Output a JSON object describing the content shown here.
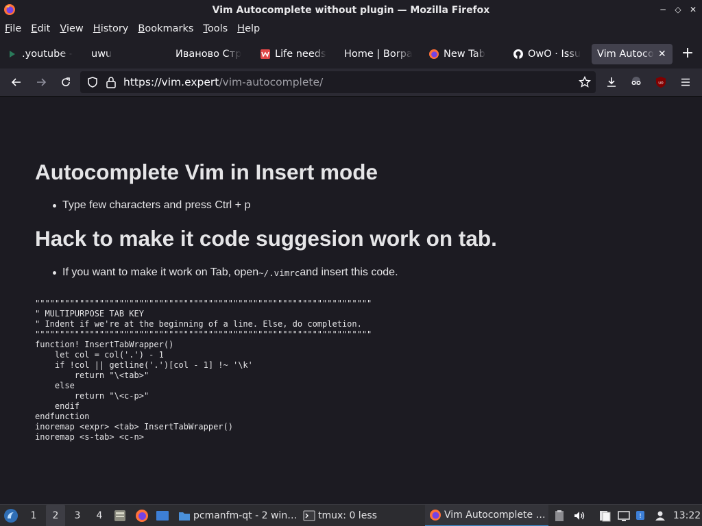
{
  "window": {
    "title": "Vim Autocomplete without plugin — Mozilla Firefox",
    "controls": [
      "−",
      "◇",
      "✕"
    ]
  },
  "menu": [
    "File",
    "Edit",
    "View",
    "History",
    "Bookmarks",
    "Tools",
    "Help"
  ],
  "tabs": [
    {
      "label": ".youtube -",
      "icon": "youtube-favicon"
    },
    {
      "label": "uwu",
      "icon": "none"
    },
    {
      "label": "Иваново Стр",
      "icon": "none"
    },
    {
      "label": "Life needs",
      "icon": "red-favicon"
    },
    {
      "label": "Home | Borpa",
      "icon": "none"
    },
    {
      "label": "New Tab",
      "icon": "firefox-favicon"
    },
    {
      "label": "OwO · Issu",
      "icon": "github-favicon"
    },
    {
      "label": "Vim Autoco",
      "icon": "none",
      "active": true
    }
  ],
  "newtab_label": "+",
  "url": {
    "host": "https://vim.expert",
    "path": "/vim-autocomplete/"
  },
  "page": {
    "heading1": "Autocomplete Vim in Insert mode",
    "bullet1": "Type few characters and press Ctrl + p",
    "heading2": "Hack to make it code suggesion work on tab.",
    "bullet2_pre": "If you want to make it work on Tab, open ",
    "bullet2_code": "~/.vimrc",
    "bullet2_post": " and insert this code.",
    "code": "\"\"\"\"\"\"\"\"\"\"\"\"\"\"\"\"\"\"\"\"\"\"\"\"\"\"\"\"\"\"\"\"\"\"\"\"\"\"\"\"\"\"\"\"\"\"\"\"\"\"\"\"\"\"\"\"\"\"\"\"\"\"\"\"\"\"\"\"\n\" MULTIPURPOSE TAB KEY\n\" Indent if we're at the beginning of a line. Else, do completion.\n\"\"\"\"\"\"\"\"\"\"\"\"\"\"\"\"\"\"\"\"\"\"\"\"\"\"\"\"\"\"\"\"\"\"\"\"\"\"\"\"\"\"\"\"\"\"\"\"\"\"\"\"\"\"\"\"\"\"\"\"\"\"\"\"\"\"\"\"\nfunction! InsertTabWrapper()\n    let col = col('.') - 1\n    if !col || getline('.')[col - 1] !~ '\\k'\n        return \"\\<tab>\"\n    else\n        return \"\\<c-p>\"\n    endif\nendfunction\ninoremap <expr> <tab> InsertTabWrapper()\ninoremap <s-tab> <c-n>"
  },
  "taskbar": {
    "workspaces": [
      "1",
      "2",
      "3",
      "4"
    ],
    "active_workspace": "2",
    "tasks": [
      {
        "label": "pcmanfm-qt - 2 win…",
        "icon": "folder-icon"
      },
      {
        "label": "tmux: 0 less",
        "icon": "terminal-icon"
      },
      {
        "label": "Vim Autocomplete …",
        "icon": "firefox-icon",
        "active": true
      }
    ],
    "clock": "13:22"
  },
  "colors": {
    "background": "#1c1b22",
    "toolbar": "#2b2a33",
    "active_tab": "#42414d",
    "taskbar": "#2c2c30"
  }
}
